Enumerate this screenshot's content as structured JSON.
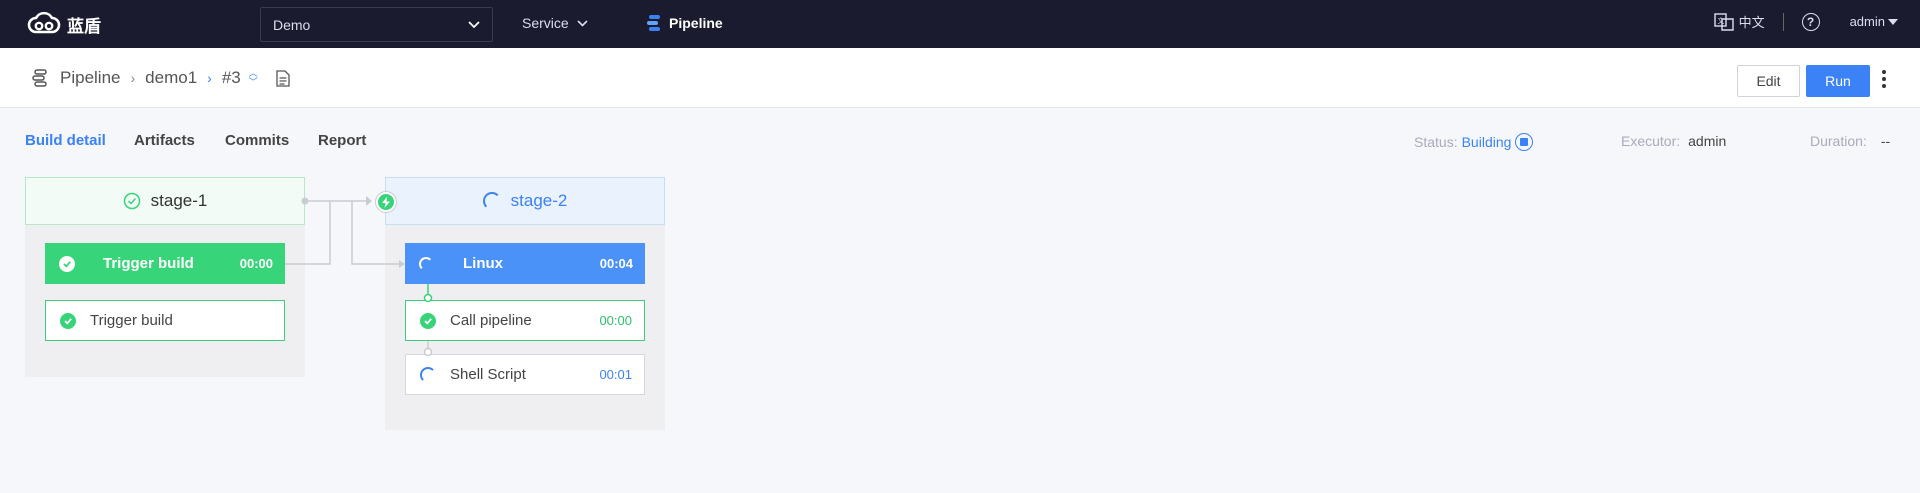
{
  "topnav": {
    "logo_text": "蓝盾",
    "project": "Demo",
    "service": "Service",
    "pipeline": "Pipeline",
    "lang": "中文",
    "help": "?",
    "user": "admin"
  },
  "breadcrumb": {
    "pipeline": "Pipeline",
    "name": "demo1",
    "run": "#3"
  },
  "actions": {
    "edit": "Edit",
    "run": "Run"
  },
  "tabs": [
    "Build detail",
    "Artifacts",
    "Commits",
    "Report"
  ],
  "info": {
    "status_label": "Status:",
    "status_value": "Building",
    "executor_label": "Executor:",
    "executor_value": "admin",
    "duration_label": "Duration:",
    "duration_value": "--"
  },
  "stages": [
    {
      "name": "stage-1",
      "status": "success",
      "job": {
        "name": "Trigger build",
        "time": "00:00"
      },
      "tasks": [
        {
          "name": "Trigger build",
          "time": ""
        }
      ]
    },
    {
      "name": "stage-2",
      "status": "running",
      "job": {
        "name": "Linux",
        "time": "00:04"
      },
      "tasks": [
        {
          "name": "Call pipeline",
          "time": "00:00",
          "status": "success"
        },
        {
          "name": "Shell Script",
          "time": "00:01",
          "status": "running"
        }
      ]
    }
  ],
  "colors": {
    "accent": "#3b82f6",
    "success": "#38d47a",
    "nav_bg": "#1a1b2e"
  }
}
